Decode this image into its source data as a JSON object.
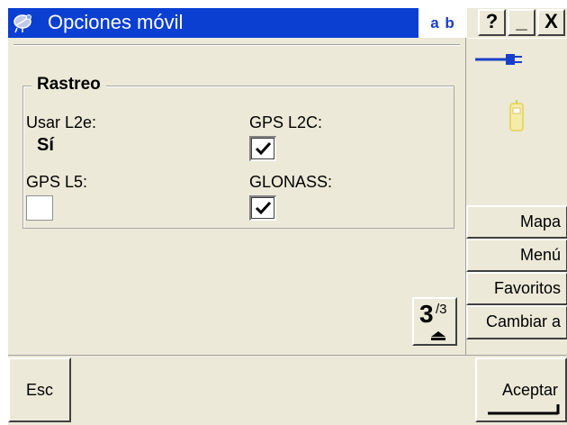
{
  "window": {
    "title": "Opciones móvil",
    "input_mode": "a b",
    "help_button": "?",
    "minimize_button": "_",
    "close_button": "X"
  },
  "group": {
    "title": "Rastreo",
    "fields": {
      "usar_l2e": {
        "label": "Usar L2e:",
        "value": "Sí"
      },
      "gps_l2c": {
        "label": "GPS L2C:",
        "checked": true
      },
      "gps_l5": {
        "label": "GPS L5:",
        "checked": false
      },
      "glonass": {
        "label": "GLONASS:",
        "checked": true
      }
    }
  },
  "page_indicator": {
    "current": "3",
    "total": "/3"
  },
  "sidebar": {
    "buttons": [
      "Mapa",
      "Menú",
      "Favoritos",
      "Cambiar a"
    ]
  },
  "footer": {
    "esc_label": "Esc",
    "accept_label": "Aceptar"
  },
  "colors": {
    "titlebar": "#0a3fd2",
    "background": "#ece9d8",
    "accent_blue": "#1a3fc7",
    "icon_yellow": "#e8d86a"
  },
  "icons": {
    "app": "satellite-dish-icon",
    "power": "power-plug-icon",
    "receiver": "gnss-receiver-icon"
  }
}
